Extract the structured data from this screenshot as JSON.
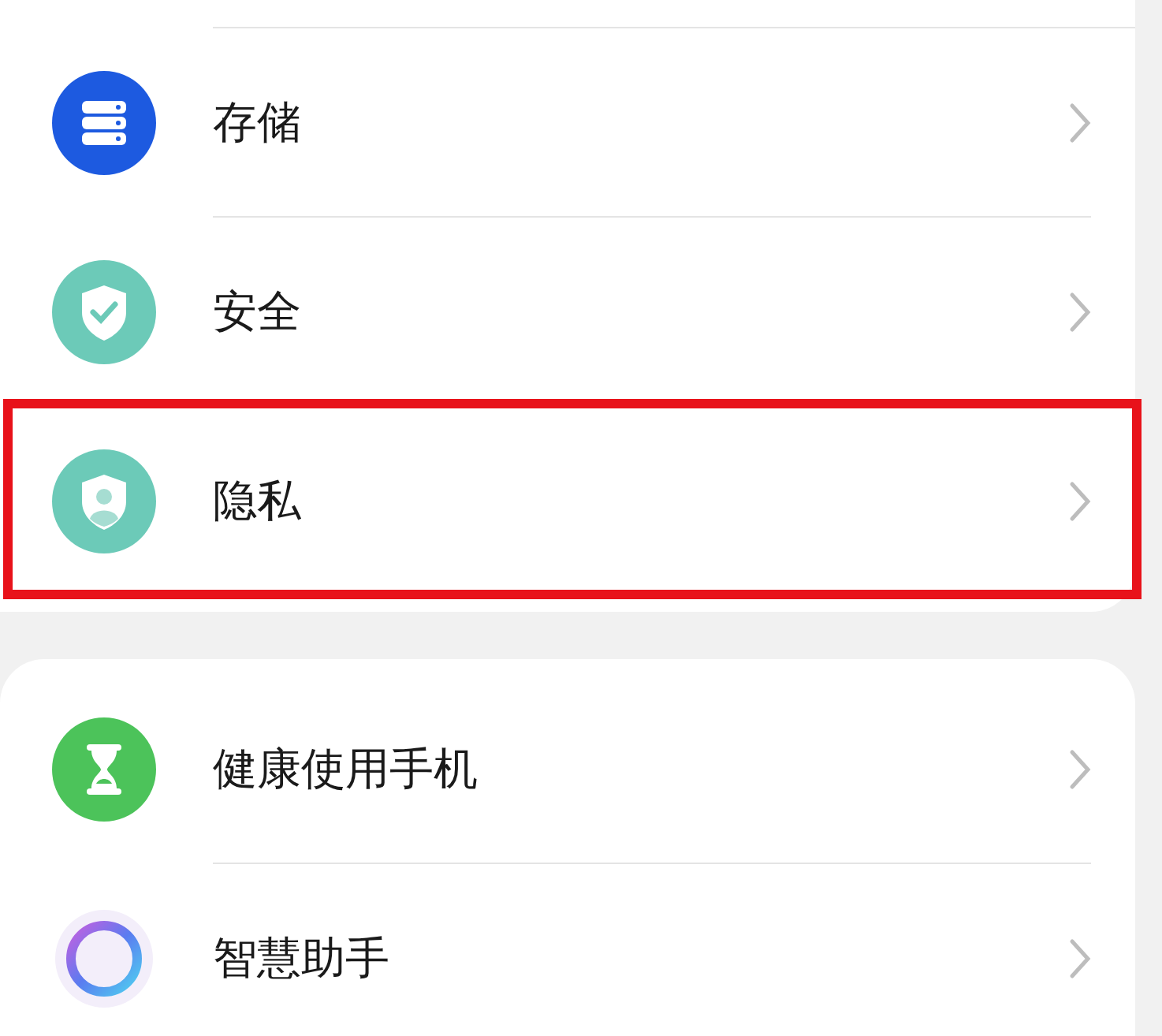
{
  "groups": [
    {
      "items": [
        {
          "label": "存储",
          "kind": "storage",
          "highlighted": false
        },
        {
          "label": "安全",
          "kind": "security",
          "highlighted": false
        },
        {
          "label": "隐私",
          "kind": "privacy",
          "highlighted": true
        }
      ]
    },
    {
      "items": [
        {
          "label": "健康使用手机",
          "kind": "health",
          "highlighted": false
        },
        {
          "label": "智慧助手",
          "kind": "assistant",
          "highlighted": false
        }
      ]
    }
  ]
}
